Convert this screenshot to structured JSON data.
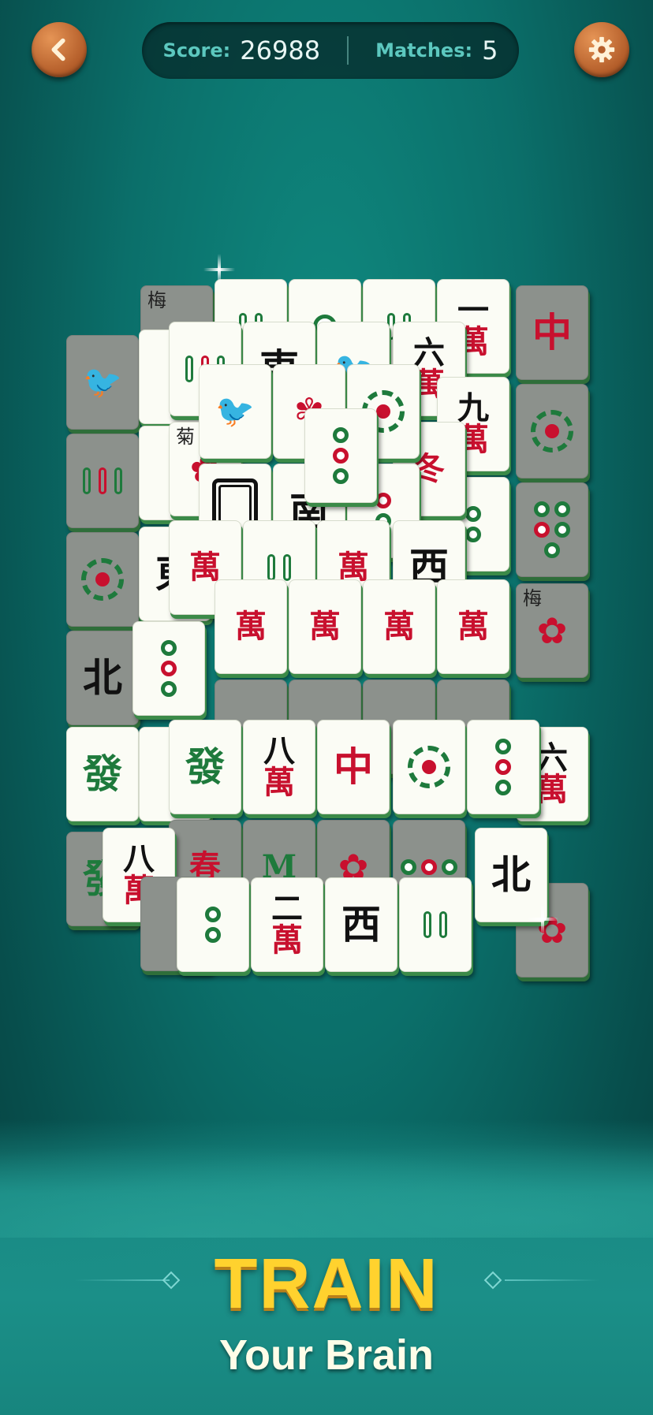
{
  "hud": {
    "score_label": "Score:",
    "score_value": "26988",
    "matches_label": "Matches:",
    "matches_value": "5"
  },
  "buttons": {
    "back_icon": "chevron-left-icon",
    "settings_icon": "gear-icon"
  },
  "tiles": {
    "plum": "梅",
    "chrysanthemum": "菊",
    "winter": "冬",
    "spring": "春",
    "red_dragon": "中",
    "green_dragon": "發",
    "north": "北",
    "south": "南",
    "east": "東",
    "west": "西",
    "wan": "萬",
    "one": "一",
    "two": "二",
    "six": "六",
    "eight": "八",
    "nine": "九"
  },
  "promo": {
    "title": "TRAIN",
    "subtitle": "Your Brain"
  },
  "colors": {
    "background": "#0b6f6a",
    "title_yellow": "#ffd22e",
    "tile_red": "#c8102e",
    "tile_green": "#1e7a3c"
  }
}
